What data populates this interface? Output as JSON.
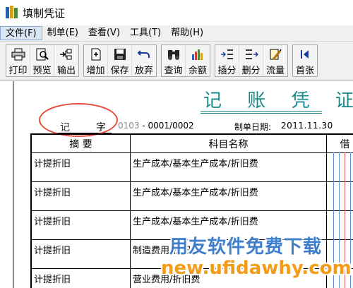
{
  "window": {
    "title": "填制凭证"
  },
  "menu": [
    "文件(F)",
    "制单(E)",
    "查看(V)",
    "工具(T)",
    "帮助(H)"
  ],
  "toolbar": [
    {
      "label": "打印",
      "icon": "printer-icon"
    },
    {
      "label": "预览",
      "icon": "preview-icon"
    },
    {
      "label": "输出",
      "icon": "export-icon"
    },
    {
      "label": "增加",
      "icon": "add-icon"
    },
    {
      "label": "保存",
      "icon": "save-icon"
    },
    {
      "label": "放弃",
      "icon": "undo-icon"
    },
    {
      "label": "查询",
      "icon": "binoculars-icon"
    },
    {
      "label": "余额",
      "icon": "balance-chart-icon"
    },
    {
      "label": "插分",
      "icon": "insert-entry-icon"
    },
    {
      "label": "删分",
      "icon": "delete-entry-icon"
    },
    {
      "label": "流量",
      "icon": "cashflow-icon"
    },
    {
      "label": "首张",
      "icon": "first-page-icon"
    }
  ],
  "voucher": {
    "title": "记 账 凭 证",
    "word": "记",
    "word_suffix": "字",
    "number_prefix": "0103",
    "number": "- 0001/0002",
    "make_date_label": "制单日期:",
    "make_date": "2011.11.30",
    "columns": [
      "摘 要",
      "科目名称",
      "借"
    ],
    "rows": [
      {
        "summary": "计提折旧",
        "account": "生产成本/基本生产成本/折旧费"
      },
      {
        "summary": "计提折旧",
        "account": "生产成本/基本生产成本/折旧费"
      },
      {
        "summary": "计提折旧",
        "account": "生产成本/基本生产成本/折旧费"
      },
      {
        "summary": "计提折旧",
        "account": "制造费用/折旧"
      },
      {
        "summary": "计提折旧",
        "account": "营业费用/折旧费"
      }
    ]
  },
  "watermark": {
    "line1": "用友软件免费下载",
    "line2": "new.ufidawhy.com"
  },
  "colors": {
    "title_teal": "#1a8a8a",
    "annotation_red": "#e84a3a",
    "watermark_blue": "#3f7fcc",
    "watermark_orange": "#f39c1a"
  }
}
